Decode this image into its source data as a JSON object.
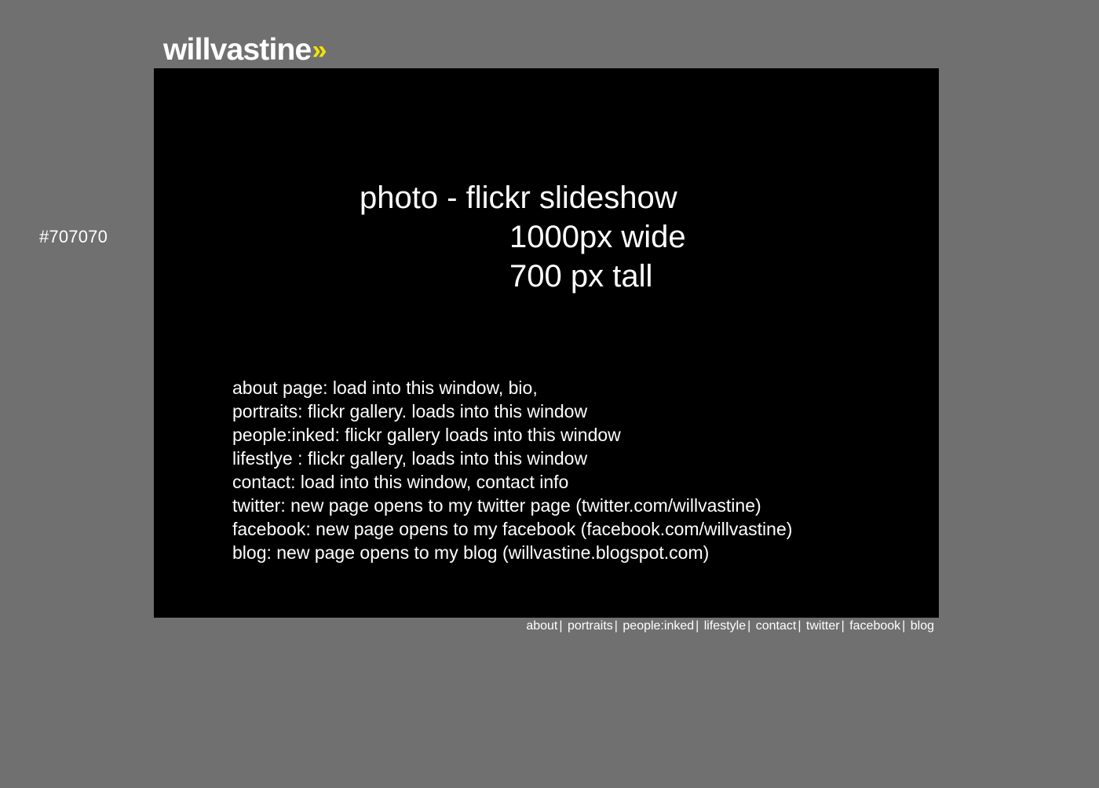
{
  "page": {
    "background_color": "#707070",
    "background_note": "#707070"
  },
  "logo": {
    "text": "willvastine",
    "chevron": "»",
    "accent_color": "#f2e600"
  },
  "stage": {
    "background_color": "#000000",
    "placeholder_lines": [
      "photo - flickr slideshow",
      "1000px wide",
      "700 px tall"
    ],
    "notes": [
      "about page: load into this window, bio,",
      "portraits: flickr gallery. loads into this window",
      "people:inked: flickr gallery loads into this window",
      "lifestlye : flickr gallery, loads into this window",
      "contact: load into this window, contact info",
      "twitter: new page opens to my twitter page (twitter.com/willvastine)",
      "facebook: new page opens to my facebook (facebook.com/willvastine)",
      "blog: new page opens to my blog (willvastine.blogspot.com)"
    ]
  },
  "footer_nav": {
    "separator": "|",
    "items": [
      "about",
      "portraits",
      "people:inked",
      "lifestyle",
      "contact",
      "twitter",
      "facebook",
      "blog"
    ]
  }
}
